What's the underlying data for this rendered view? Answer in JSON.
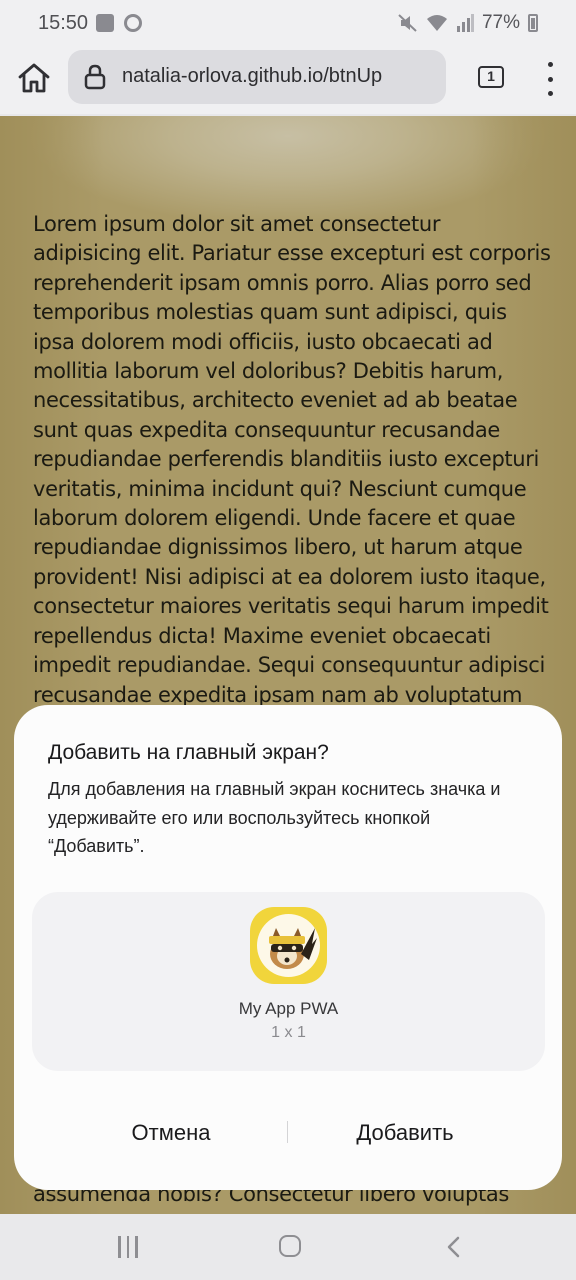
{
  "status_bar": {
    "time": "15:50",
    "battery": "77%",
    "icons_left": [
      "gallery-icon",
      "chrome-icon"
    ],
    "icons_right": [
      "mute-icon",
      "wifi-icon",
      "signal-icon",
      "battery-icon"
    ]
  },
  "browser": {
    "url": "natalia-orlova.github.io/btnUp",
    "tab_count": "1"
  },
  "page": {
    "text": "Lorem ipsum dolor sit amet consectetur adipisicing elit. Pariatur esse excepturi est corporis reprehenderit ipsam omnis porro. Alias porro sed temporibus molestias quam sunt adipisci, quis ipsa dolorem modi officiis, iusto obcaecati ad mollitia laborum vel doloribus? Debitis harum, necessitatibus, architecto eveniet ad ab beatae sunt quas expedita consequuntur recusandae repudiandae perferendis blanditiis iusto excepturi veritatis, minima incidunt qui? Nesciunt cumque laborum dolorem eligendi. Unde facere et quae repudiandae dignissimos libero, ut harum atque provident! Nisi adipisci at ea dolorem iusto itaque, consectetur maiores veritatis sequi harum impedit repellendus dicta! Maxime eveniet obcaecati impedit repudiandae. Sequi consequuntur adipisci recusandae expedita ipsam nam ab voluptatum",
    "text_tail": "assumenda nobis? Consectetur libero voluptas"
  },
  "dialog": {
    "title": "Добавить на главный экран?",
    "body": "Для добавления на главный экран коснитесь значка и удерживайте его или воспользуйтесь кнопкой “Добавить”.",
    "app_name": "My App PWA",
    "app_size": "1 x 1",
    "cancel_label": "Отмена",
    "add_label": "Добавить"
  },
  "colors": {
    "page_background": "#aa9a67",
    "icon_yellow": "#f1d53b",
    "dialog_background": "#fcfcfc"
  }
}
